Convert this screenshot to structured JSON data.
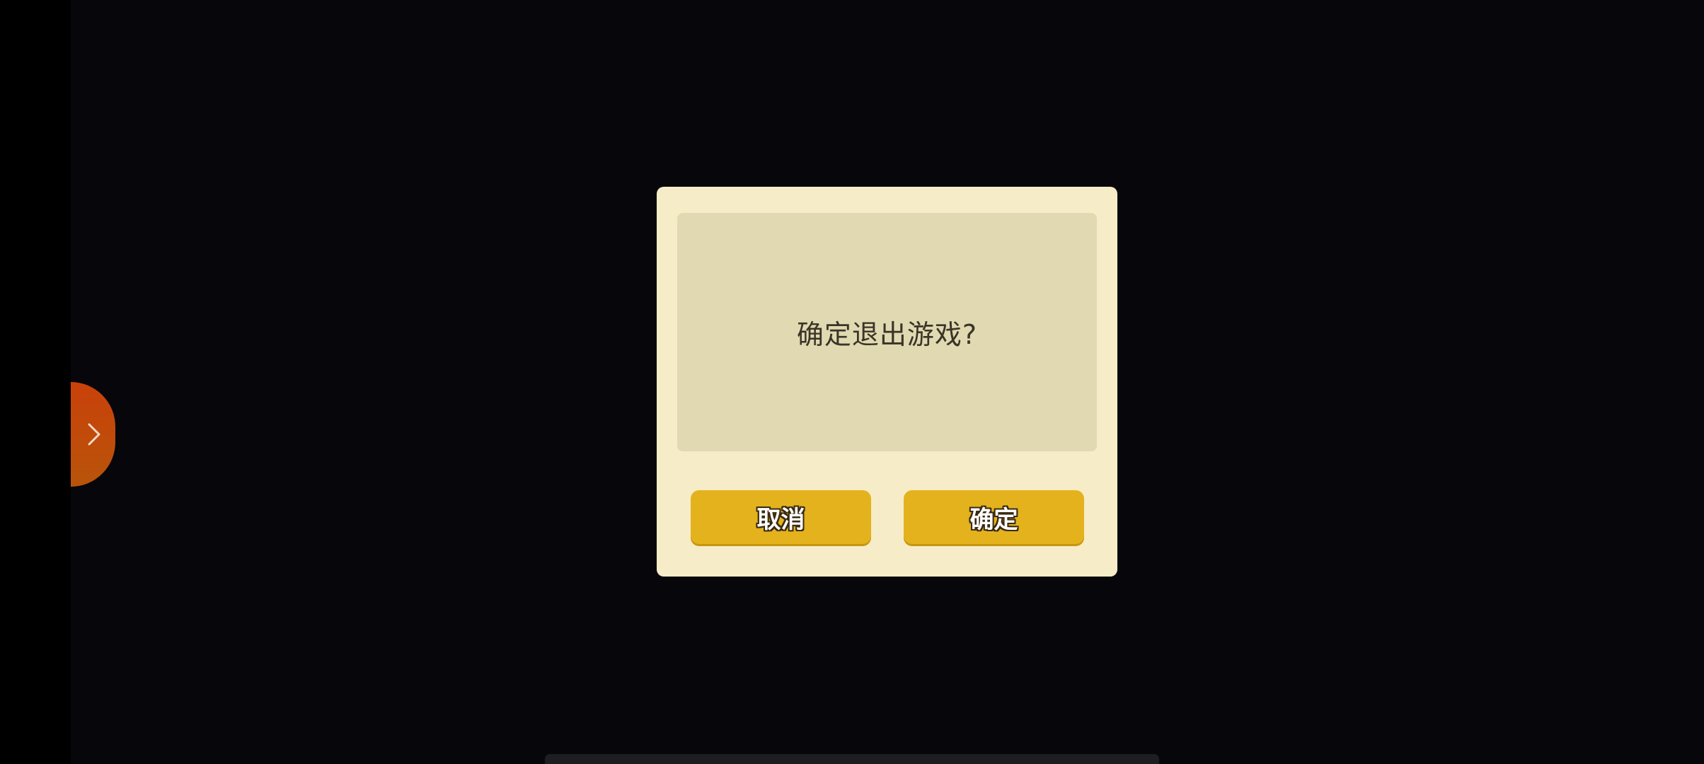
{
  "side_tab": {
    "icon": "chevron-right-icon",
    "color": "#c9410a"
  },
  "dialog": {
    "message": "确定退出游戏?",
    "cancel_label": "取消",
    "confirm_label": "确定",
    "background_color": "#f6ecc8",
    "panel_color": "#e1d9b1",
    "button_color": "#e4b21c"
  }
}
